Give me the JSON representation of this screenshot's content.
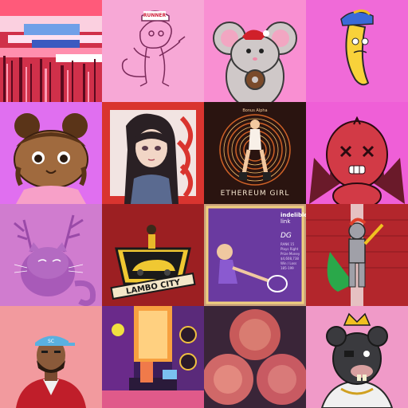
{
  "tiles": [
    {
      "name": "glitch-art-tile",
      "bg": "#e0405a"
    },
    {
      "name": "cat-with-cap-tile",
      "bg": "#f7a8d6",
      "cap_text": "RUNNER"
    },
    {
      "name": "mouse-donut-tile",
      "bg": "#f98fd2"
    },
    {
      "name": "banana-tile",
      "bg": "#f06ad8"
    },
    {
      "name": "cute-girl-tile",
      "bg": "#e06ff0"
    },
    {
      "name": "anime-girl-tile",
      "bg": "#d9342f"
    },
    {
      "name": "ethereum-girl-tile",
      "bg": "#2a1410",
      "title": "ETHEREUM GIRL",
      "subtitle": "Bonus Alpha"
    },
    {
      "name": "devil-monster-tile",
      "bg": "#ef5fd7"
    },
    {
      "name": "antler-cat-tile",
      "bg": "#d07ccf"
    },
    {
      "name": "lambo-city-tile",
      "bg": "#9c1f22",
      "sign": "LAMBO CITY"
    },
    {
      "name": "tennis-card-tile",
      "bg": "#c9a07a",
      "brand": "indelible",
      "brand2": "link",
      "code": "DG",
      "stats": [
        "RANK 15",
        "Plays Right",
        "Prize Money",
        "$4,608,738",
        "Win / Loss",
        "185-199"
      ]
    },
    {
      "name": "robot-hero-tile",
      "bg": "#b3262c"
    },
    {
      "name": "man-red-jacket-tile",
      "bg": "#f29a9e",
      "cap_text": "SC"
    },
    {
      "name": "studio-room-tile",
      "bg": "#3b1e5a"
    },
    {
      "name": "three-circles-tile",
      "bg": "#3a2538"
    },
    {
      "name": "king-rat-tile",
      "bg": "#f09ac8"
    }
  ]
}
